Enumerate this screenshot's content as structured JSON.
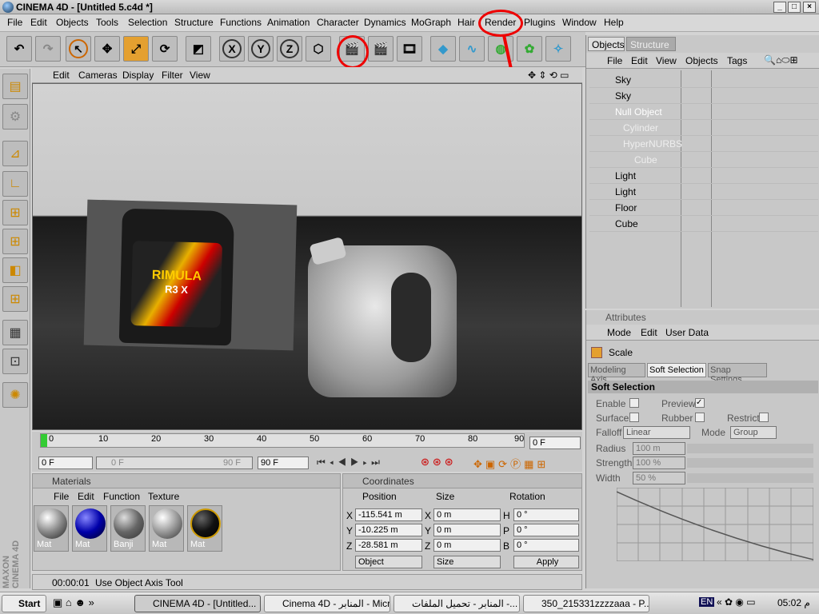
{
  "window": {
    "title": "CINEMA 4D - [Untitled 5.c4d *]"
  },
  "menu": [
    "File",
    "Edit",
    "Objects",
    "Tools",
    "Selection",
    "Structure",
    "Functions",
    "Animation",
    "Character",
    "Dynamics",
    "MoGraph",
    "Hair",
    "Render",
    "Plugins",
    "Window",
    "Help"
  ],
  "toolbar": {
    "x_label": "X",
    "y_label": "Y",
    "z_label": "Z"
  },
  "viewport": {
    "menu": [
      "Edit",
      "Cameras",
      "Display",
      "Filter",
      "View"
    ],
    "bottle_label": "RIMULA",
    "bottle_sublabel": "R3 X"
  },
  "timeline": {
    "ticks": [
      "0",
      "10",
      "20",
      "30",
      "40",
      "50",
      "60",
      "70",
      "80",
      "90"
    ],
    "current_frame": "0 F",
    "start": "0 F",
    "range_start": "0 F",
    "range_end": "90 F",
    "end": "90 F"
  },
  "materials": {
    "title": "Materials",
    "menu": [
      "File",
      "Edit",
      "Function",
      "Texture"
    ],
    "items": [
      "Mat",
      "Mat",
      "Banji",
      "Mat",
      "Mat"
    ]
  },
  "coordinates": {
    "title": "Coordinates",
    "headers": [
      "Position",
      "Size",
      "Rotation"
    ],
    "rows": [
      {
        "axis": "X",
        "pos": "-115.541 m",
        "size_axis": "X",
        "size": "0 m",
        "rot_axis": "H",
        "rot": "0 °"
      },
      {
        "axis": "Y",
        "pos": "-10.225 m",
        "size_axis": "Y",
        "size": "0 m",
        "rot_axis": "P",
        "rot": "0 °"
      },
      {
        "axis": "Z",
        "pos": "-28.581 m",
        "size_axis": "Z",
        "size": "0 m",
        "rot_axis": "B",
        "rot": "0 °"
      }
    ],
    "mode": "Object",
    "size_mode": "Size",
    "apply": "Apply"
  },
  "status": {
    "time": "00:00:01",
    "text": "Use Object Axis Tool"
  },
  "objects": {
    "tabs": [
      "Objects",
      "Structure"
    ],
    "menu": [
      "File",
      "Edit",
      "View",
      "Objects",
      "Tags"
    ],
    "items": [
      "Sky",
      "Sky",
      "Null Object",
      "Cylinder",
      "HyperNURBS",
      "Cube",
      "Light",
      "Light",
      "Floor",
      "Cube"
    ]
  },
  "attributes": {
    "title": "Attributes",
    "menu": [
      "Mode",
      "Edit",
      "User Data"
    ],
    "tool": "Scale",
    "tabs": [
      "Modeling Axis",
      "Soft Selection",
      "Snap Settings"
    ],
    "section": "Soft Selection",
    "enable": "Enable",
    "preview": "Preview",
    "surface": "Surface",
    "rubber": "Rubber",
    "restrict": "Restrict",
    "falloff_label": "Falloff",
    "falloff": "Linear",
    "mode_label": "Mode",
    "mode": "Group",
    "radius_label": "Radius",
    "radius": "100 m",
    "strength_label": "Strength",
    "strength": "100 %",
    "width_label": "Width",
    "width": "50 %"
  },
  "taskbar": {
    "start": "Start",
    "tasks": [
      "CINEMA 4D - [Untitled...",
      "Cinema 4D - المنابر - Micr...",
      "المنابر - تحميل الملفات -...",
      "350_215331zzzzaaa - P..."
    ],
    "lang": "EN",
    "clock": "05:02 م"
  },
  "logo": "MAXON CINEMA 4D"
}
